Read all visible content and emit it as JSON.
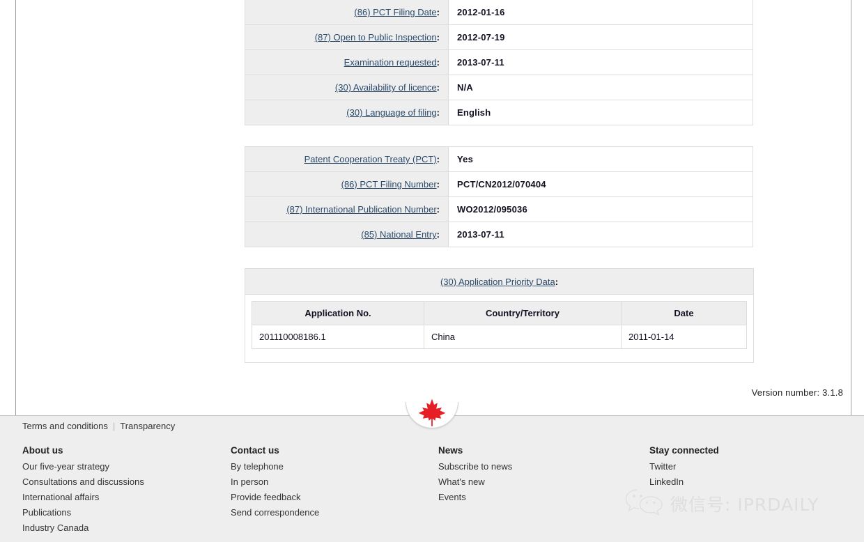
{
  "page": {
    "version_label": "Version number: 3.1.8"
  },
  "tables": {
    "filing_info": {
      "rows": [
        {
          "label": "(86) PCT Filing Date",
          "value": "2012-01-16"
        },
        {
          "label": "(87) Open to Public Inspection",
          "value": "2012-07-19"
        },
        {
          "label": "Examination requested",
          "value": "2013-07-11"
        },
        {
          "label": "(30) Availability of licence",
          "value": "N/A"
        },
        {
          "label": "(30) Language of filing",
          "value": "English"
        }
      ]
    },
    "pct_info": {
      "rows": [
        {
          "label": "Patent Cooperation Treaty (PCT)",
          "value": "Yes"
        },
        {
          "label": "(86) PCT Filing Number",
          "value": "PCT/CN2012/070404"
        },
        {
          "label": "(87) International Publication Number",
          "value": "WO2012/095036"
        },
        {
          "label": "(85) National Entry",
          "value": "2013-07-11"
        }
      ]
    },
    "priority_data": {
      "heading": "(30) Application Priority Data",
      "columns": [
        "Application No.",
        "Country/Territory",
        "Date"
      ],
      "rows": [
        [
          "201110008186.1",
          "China",
          "2011-01-14"
        ]
      ]
    }
  },
  "footer": {
    "top_links": [
      {
        "label": "Terms and conditions"
      },
      {
        "label": "Transparency"
      }
    ],
    "separator": "|",
    "columns": [
      {
        "title": "About us",
        "links": [
          "Our five-year strategy",
          "Consultations and discussions",
          "International affairs",
          "Publications",
          "Industry Canada"
        ]
      },
      {
        "title": "Contact us",
        "links": [
          "By telephone",
          "In person",
          "Provide feedback",
          "Send correspondence"
        ]
      },
      {
        "title": "News",
        "links": [
          "Subscribe to news",
          "What's new",
          "Events"
        ]
      },
      {
        "title": "Stay connected",
        "links": [
          "Twitter",
          "LinkedIn"
        ]
      }
    ]
  },
  "watermark": {
    "text": "微信号: IPRDAILY",
    "icon": "wechat-icon"
  },
  "colors": {
    "link": "#2a4a6b",
    "cell_label_bg": "#eeeeee",
    "footer_bg": "#eeeeee",
    "maple_leaf": "#e61e26",
    "border": "#dcdcdc"
  }
}
